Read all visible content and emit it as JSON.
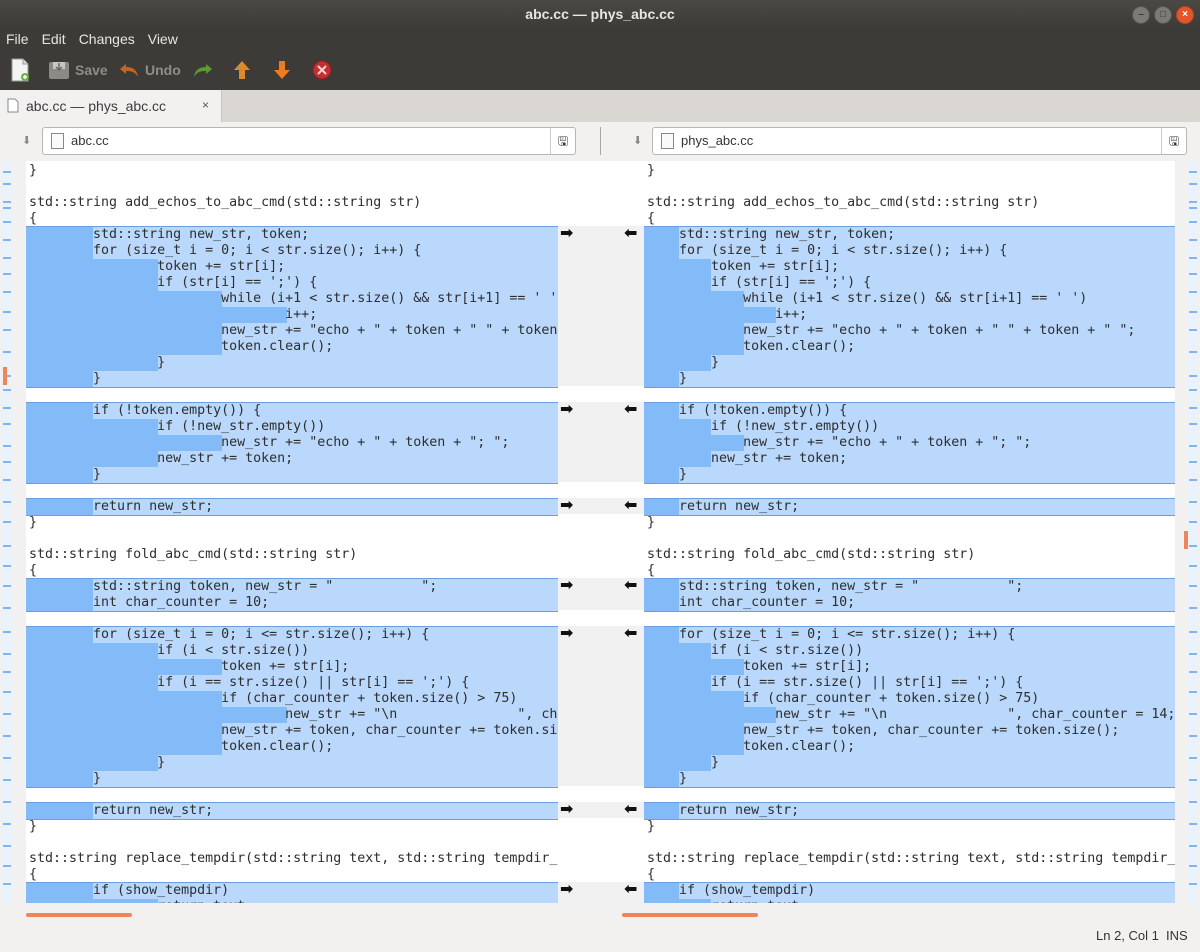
{
  "window": {
    "title": "abc.cc — phys_abc.cc"
  },
  "menu": [
    "File",
    "Edit",
    "Changes",
    "View"
  ],
  "toolbar": {
    "save": "Save",
    "undo": "Undo"
  },
  "tab": {
    "label": "abc.cc — phys_abc.cc",
    "close": "×"
  },
  "files": {
    "left": "abc.cc",
    "right": "phys_abc.cc"
  },
  "colors": {
    "changed": "#bad8fb",
    "changed_inline": "#82bbf7",
    "change_border": "#6a9ee0",
    "scroll_accent": "#f0845a"
  },
  "left_lines": [
    "}",
    "",
    "std::string add_echos_to_abc_cmd(std::string str)",
    "{",
    "        std::string new_str, token;",
    "        for (size_t i = 0; i < str.size(); i++) {",
    "                token += str[i];",
    "                if (str[i] == ';') {",
    "                        while (i+1 < str.size() && str[i+1] == ' '",
    "                                i++;",
    "                        new_str += \"echo + \" + token + \" \" + token",
    "                        token.clear();",
    "                }",
    "        }",
    "",
    "        if (!token.empty()) {",
    "                if (!new_str.empty())",
    "                        new_str += \"echo + \" + token + \"; \";",
    "                new_str += token;",
    "        }",
    "",
    "        return new_str;",
    "}",
    "",
    "std::string fold_abc_cmd(std::string str)",
    "{",
    "        std::string token, new_str = \"           \";",
    "        int char_counter = 10;",
    "",
    "        for (size_t i = 0; i <= str.size(); i++) {",
    "                if (i < str.size())",
    "                        token += str[i];",
    "                if (i == str.size() || str[i] == ';') {",
    "                        if (char_counter + token.size() > 75)",
    "                                new_str += \"\\n               \", cha",
    "                        new_str += token, char_counter += token.si",
    "                        token.clear();",
    "                }",
    "        }",
    "",
    "        return new_str;",
    "}",
    "",
    "std::string replace_tempdir(std::string text, std::string tempdir_",
    "{",
    "        if (show_tempdir)",
    "                return text;"
  ],
  "right_lines": [
    "}",
    "",
    "std::string add_echos_to_abc_cmd(std::string str)",
    "{",
    "    std::string new_str, token;",
    "    for (size_t i = 0; i < str.size(); i++) {",
    "        token += str[i];",
    "        if (str[i] == ';') {",
    "            while (i+1 < str.size() && str[i+1] == ' ')",
    "                i++;",
    "            new_str += \"echo + \" + token + \" \" + token + \" \";",
    "            token.clear();",
    "        }",
    "    }",
    "",
    "    if (!token.empty()) {",
    "        if (!new_str.empty())",
    "            new_str += \"echo + \" + token + \"; \";",
    "        new_str += token;",
    "    }",
    "",
    "    return new_str;",
    "}",
    "",
    "std::string fold_abc_cmd(std::string str)",
    "{",
    "    std::string token, new_str = \"           \";",
    "    int char_counter = 10;",
    "",
    "    for (size_t i = 0; i <= str.size(); i++) {",
    "        if (i < str.size())",
    "            token += str[i];",
    "        if (i == str.size() || str[i] == ';') {",
    "            if (char_counter + token.size() > 75)",
    "                new_str += \"\\n               \", char_counter = 14;",
    "            new_str += token, char_counter += token.size();",
    "            token.clear();",
    "        }",
    "    }",
    "",
    "    return new_str;",
    "}",
    "",
    "std::string replace_tempdir(std::string text, std::string tempdir_",
    "{",
    "    if (show_tempdir)",
    "        return text;"
  ],
  "change_arrows": {
    "left": "➡",
    "right": "⬅"
  },
  "status": {
    "position": "Ln 2, Col 1",
    "mode": "INS"
  }
}
